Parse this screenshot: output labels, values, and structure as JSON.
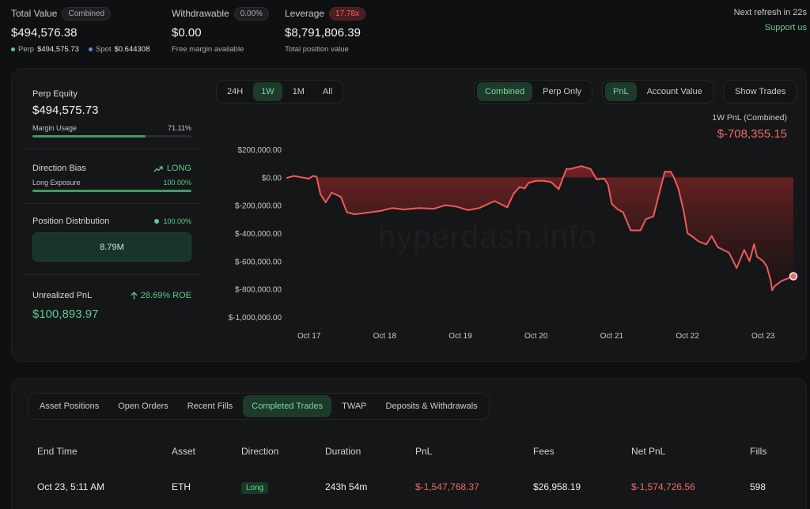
{
  "summary": {
    "total_value_label": "Total Value",
    "total_value_pill": "Combined",
    "total_value": "$494,576.38",
    "perp_label": "Perp",
    "perp_value": "$494,575.73",
    "spot_label": "Spot",
    "spot_value": "$0.644308",
    "withdrawable_label": "Withdrawable",
    "withdrawable_pill": "0.00%",
    "withdrawable": "$0.00",
    "withdrawable_sub": "Free margin available",
    "leverage_label": "Leverage",
    "leverage_pill": "17.78x",
    "leverage_value": "$8,791,806.39",
    "leverage_sub": "Total position value",
    "refresh": "Next refresh in 22s",
    "support": "Support us"
  },
  "left_panel": {
    "perp_equity_label": "Perp Equity",
    "perp_equity": "$494,575.73",
    "margin_usage_label": "Margin Usage",
    "margin_usage": "71.11%",
    "margin_usage_fraction": 0.7111,
    "direction_bias_label": "Direction Bias",
    "direction_bias": "LONG",
    "long_exposure_label": "Long Exposure",
    "long_exposure": "100.00%",
    "long_exposure_fraction": 1.0,
    "position_distribution_label": "Position Distribution",
    "position_distribution_pct": "100.00%",
    "position_distribution_value": "8.79M",
    "unrealized_label": "Unrealized PnL",
    "roe": "28.69% ROE",
    "unrealized_value": "$100,893.97"
  },
  "range_tabs": [
    "24H",
    "1W",
    "1M",
    "All"
  ],
  "range_selected": "1W",
  "mode_tabs": [
    "Combined",
    "Perp Only"
  ],
  "mode_selected": "Combined",
  "metric_tabs": [
    "PnL",
    "Account Value"
  ],
  "metric_selected": "PnL",
  "show_trades": "Show Trades",
  "chart_header": {
    "title": "1W PnL (Combined)",
    "value": "$-708,355.15"
  },
  "watermark": "hyperdash.info",
  "chart_data": {
    "type": "area",
    "y_ticks": [
      "$200,000.00",
      "$0.00",
      "$-200,000.00",
      "$-400,000.00",
      "$-600,000.00",
      "$-800,000.00",
      "$-1,000,000.00"
    ],
    "x_ticks": [
      "Oct 17",
      "Oct 18",
      "Oct 19",
      "Oct 20",
      "Oct 21",
      "Oct 22",
      "Oct 23"
    ],
    "ylim": [
      -1000000,
      200000
    ],
    "x": [
      16.7,
      16.8,
      16.9,
      17.0,
      17.05,
      17.1,
      17.15,
      17.22,
      17.3,
      17.42,
      17.5,
      17.6,
      17.75,
      17.95,
      18.1,
      18.25,
      18.45,
      18.65,
      18.8,
      18.95,
      19.1,
      19.25,
      19.45,
      19.62,
      19.7,
      19.78,
      19.85,
      19.9,
      20.0,
      20.1,
      20.2,
      20.3,
      20.4,
      20.45,
      20.6,
      20.72,
      20.8,
      20.9,
      20.95,
      21.0,
      21.08,
      21.15,
      21.25,
      21.38,
      21.45,
      21.55,
      21.7,
      21.78,
      21.82,
      21.88,
      21.95,
      22.0,
      22.08,
      22.15,
      22.25,
      22.32,
      22.4,
      22.55,
      22.65,
      22.75,
      22.82,
      22.88,
      22.92,
      22.95,
      23.0,
      23.05,
      23.1,
      23.12,
      23.15,
      23.2,
      23.25,
      23.3,
      23.35,
      23.4
    ],
    "values": [
      -5000,
      10000,
      0,
      -10000,
      10000,
      5000,
      -120000,
      -180000,
      -110000,
      -140000,
      -250000,
      -265000,
      -255000,
      -240000,
      -220000,
      -230000,
      -220000,
      -225000,
      -200000,
      -210000,
      -235000,
      -220000,
      -170000,
      -215000,
      -120000,
      -70000,
      -80000,
      -40000,
      -25000,
      -25000,
      -35000,
      -85000,
      60000,
      60000,
      80000,
      60000,
      -15000,
      -10000,
      -50000,
      -190000,
      -230000,
      -250000,
      -380000,
      -380000,
      -300000,
      -280000,
      40000,
      40000,
      0,
      -80000,
      -240000,
      -400000,
      -430000,
      -460000,
      -480000,
      -420000,
      -500000,
      -540000,
      -650000,
      -520000,
      -600000,
      -480000,
      -570000,
      -580000,
      -600000,
      -640000,
      -740000,
      -810000,
      -780000,
      -760000,
      -740000,
      -730000,
      -720000,
      -708355
    ],
    "xlabel": "",
    "ylabel": "",
    "grid": false,
    "colors": {
      "line": "#ef5a5a",
      "fill_top": "#7a2424",
      "fill_bottom": "#1a1213"
    }
  },
  "bottom_tabs": [
    "Asset Positions",
    "Open Orders",
    "Recent Fills",
    "Completed Trades",
    "TWAP",
    "Deposits & Withdrawals"
  ],
  "bottom_selected": "Completed Trades",
  "table": {
    "headers": [
      "End Time",
      "Asset",
      "Direction",
      "Duration",
      "PnL",
      "Fees",
      "Net PnL",
      "Fills"
    ],
    "rows": [
      [
        "Oct 23, 5:11 AM",
        "ETH",
        "Long",
        "243h 54m",
        "$-1,547,768.37",
        "$26,958.19",
        "$-1,574,726.56",
        "598"
      ]
    ]
  },
  "colors": {
    "accent": "#5ecb8e",
    "negative": "#ef6a6a"
  }
}
